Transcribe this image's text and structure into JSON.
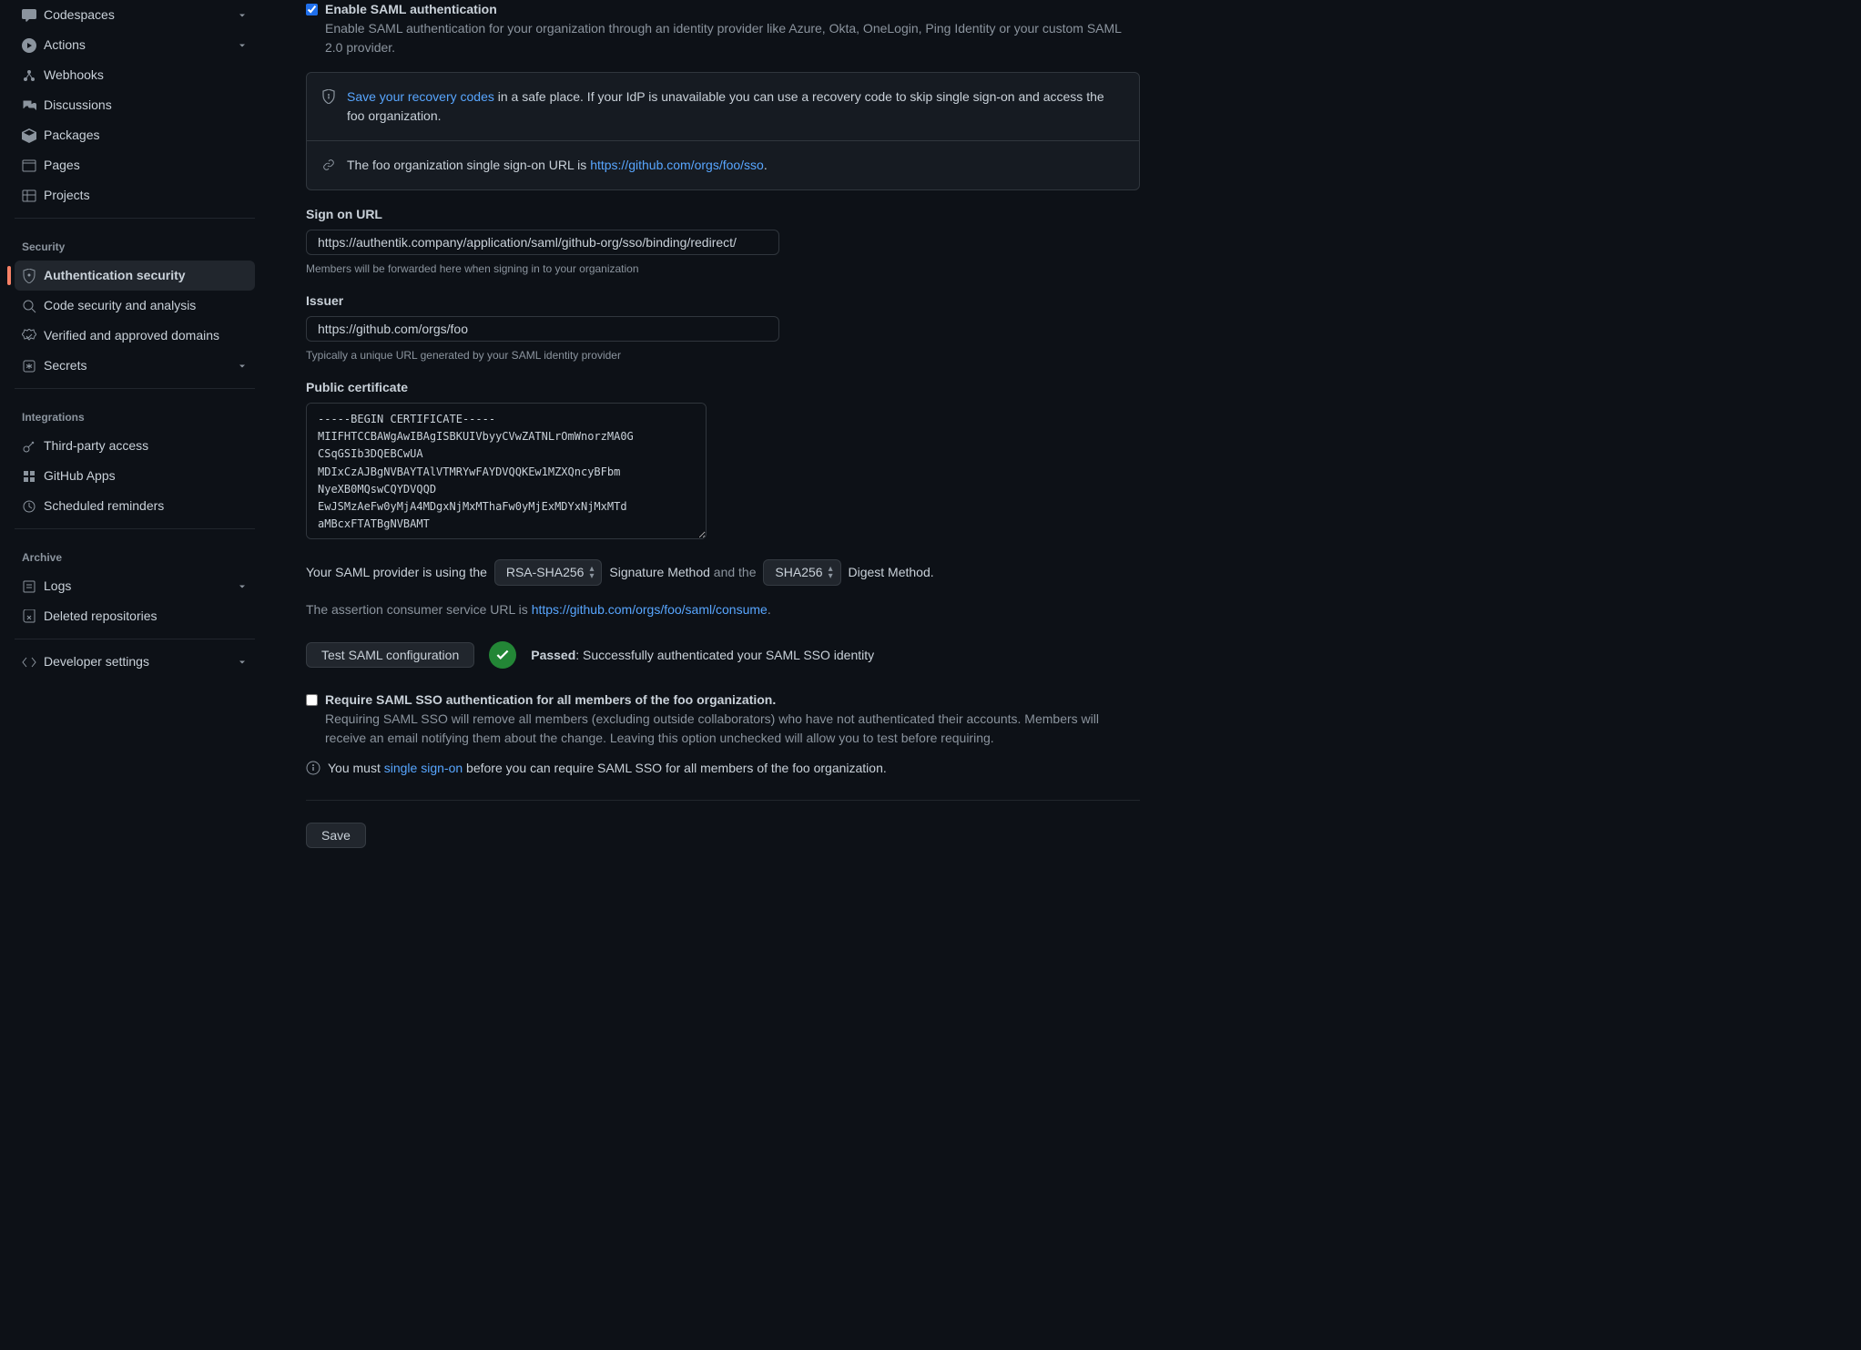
{
  "sidebar": {
    "top_items": [
      {
        "label": "Codespaces",
        "icon": "codespaces",
        "chevron": true
      },
      {
        "label": "Actions",
        "icon": "play",
        "chevron": true
      },
      {
        "label": "Webhooks",
        "icon": "webhook",
        "chevron": false
      },
      {
        "label": "Discussions",
        "icon": "discussion",
        "chevron": false
      },
      {
        "label": "Packages",
        "icon": "package",
        "chevron": false
      },
      {
        "label": "Pages",
        "icon": "browser",
        "chevron": false
      },
      {
        "label": "Projects",
        "icon": "table",
        "chevron": false
      }
    ],
    "security_title": "Security",
    "security_items": [
      {
        "label": "Authentication security",
        "icon": "shield",
        "active": true
      },
      {
        "label": "Code security and analysis",
        "icon": "codescan"
      },
      {
        "label": "Verified and approved domains",
        "icon": "verified"
      },
      {
        "label": "Secrets",
        "icon": "asterisk",
        "chevron": true
      }
    ],
    "integrations_title": "Integrations",
    "integrations_items": [
      {
        "label": "Third-party access",
        "icon": "key"
      },
      {
        "label": "GitHub Apps",
        "icon": "apps"
      },
      {
        "label": "Scheduled reminders",
        "icon": "clock"
      }
    ],
    "archive_title": "Archive",
    "archive_items": [
      {
        "label": "Logs",
        "icon": "log",
        "chevron": true
      },
      {
        "label": "Deleted repositories",
        "icon": "repo-del"
      }
    ],
    "developer_label": "Developer settings"
  },
  "main": {
    "enable_title": "Enable SAML authentication",
    "enable_desc": "Enable SAML authentication for your organization through an identity provider like Azure, Okta, OneLogin, Ping Identity or your custom SAML 2.0 provider.",
    "recovery_link": "Save your recovery codes",
    "recovery_text": " in a safe place. If your IdP is unavailable you can use a recovery code to skip single sign-on and access the foo organization.",
    "sso_url_prefix": "The foo organization single sign-on URL is ",
    "sso_url": "https://github.com/orgs/foo/sso",
    "sign_on_label": "Sign on URL",
    "sign_on_value": "https://authentik.company/application/saml/github-org/sso/binding/redirect/",
    "sign_on_hint": "Members will be forwarded here when signing in to your organization",
    "issuer_label": "Issuer",
    "issuer_value": "https://github.com/orgs/foo",
    "issuer_hint": "Typically a unique URL generated by your SAML identity provider",
    "cert_label": "Public certificate",
    "cert_value": "-----BEGIN CERTIFICATE-----\nMIIFHTCCBAWgAwIBAgISBKUIVbyyCVwZATNLrOmWnorzMA0G\nCSqGSIb3DQEBCwUA\nMDIxCzAJBgNVBAYTAlVTMRYwFAYDVQQKEw1MZXQncyBFbm\nNyeXB0MQswCQYDVQQD\nEwJSMzAeFw0yMjA4MDgxNjMxMThaFw0yMjExMDYxNjMxMTd\naMBcxFTATBgNVBAMT",
    "sig_prefix": "Your SAML provider is using the",
    "sig_select": "RSA-SHA256",
    "sig_mid": "Signature Method",
    "sig_and": " and the ",
    "digest_select": "SHA256",
    "digest_suffix": "Digest Method.",
    "acs_prefix": "The assertion consumer service URL is ",
    "acs_url": "https://github.com/orgs/foo/saml/consume",
    "test_btn": "Test SAML configuration",
    "passed_bold": "Passed",
    "passed_rest": ": Successfully authenticated your SAML SSO identity",
    "require_title": "Require SAML SSO authentication for all members of the foo organization.",
    "require_desc": "Requiring SAML SSO will remove all members (excluding outside collaborators) who have not authenticated their accounts. Members will receive an email notifying them about the change. Leaving this option unchecked will allow you to test before requiring.",
    "must_prefix": "You must ",
    "must_link": "single sign-on",
    "must_suffix": " before you can require SAML SSO for all members of the foo organization.",
    "save_btn": "Save"
  }
}
